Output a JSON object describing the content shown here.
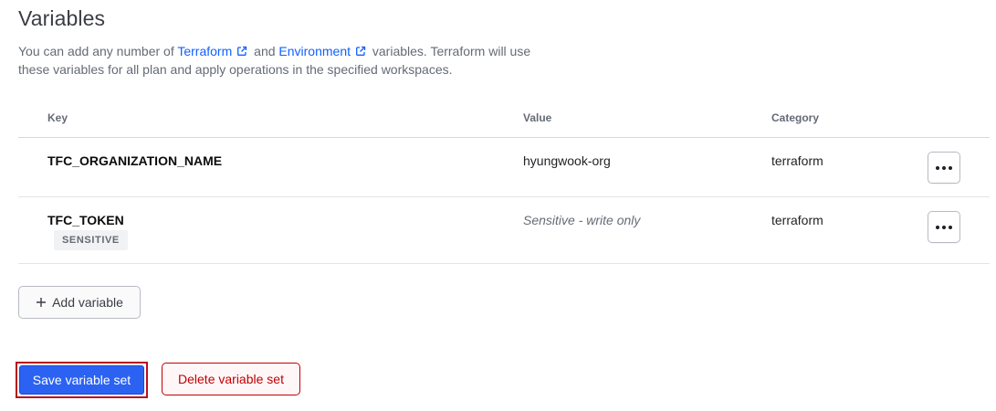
{
  "section": {
    "title": "Variables",
    "description": {
      "part1": "You can add any number of ",
      "link1": "Terraform",
      "part2": " and ",
      "link2": "Environment",
      "part3": " variables. Terraform will use these variables for all plan and apply operations in the specified workspaces."
    }
  },
  "table": {
    "headers": {
      "key": "Key",
      "value": "Value",
      "category": "Category"
    },
    "rows": [
      {
        "key": "TFC_ORGANIZATION_NAME",
        "value": "hyungwook-org",
        "category": "terraform",
        "badge": ""
      },
      {
        "key": "TFC_TOKEN",
        "value": "Sensitive - write only",
        "category": "terraform",
        "badge": "SENSITIVE"
      }
    ]
  },
  "actions": {
    "add_variable": "Add variable",
    "save": "Save variable set",
    "delete": "Delete variable set"
  },
  "icons": {
    "external_link": "external-link-icon",
    "more": "ellipsis-icon",
    "add": "plus-icon"
  },
  "colors": {
    "link": "#1060ff",
    "primary": "#2b62f2",
    "danger": "#c00005",
    "highlight": "#b5121b"
  }
}
